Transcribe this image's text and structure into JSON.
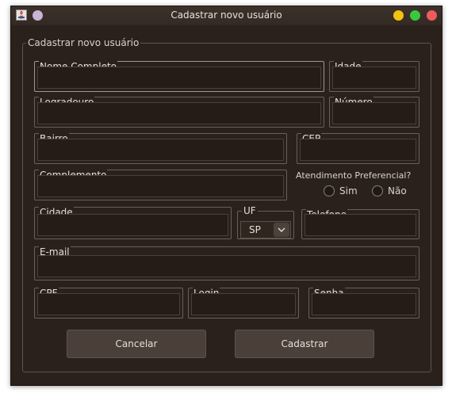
{
  "window": {
    "title": "Cadastrar novo usuário"
  },
  "form": {
    "group_title": "Cadastrar novo usuário",
    "fields": {
      "nome": {
        "label": "Nome Completo",
        "value": ""
      },
      "idade": {
        "label": "Idade",
        "value": ""
      },
      "logradouro": {
        "label": "Logradouro",
        "value": ""
      },
      "numero": {
        "label": "Número",
        "value": ""
      },
      "bairro": {
        "label": "Bairro",
        "value": ""
      },
      "cep": {
        "label": "CEP",
        "value": ""
      },
      "complemento": {
        "label": "Complemento",
        "value": ""
      },
      "cidade": {
        "label": "Cidade",
        "value": ""
      },
      "telefone": {
        "label": "Telefone",
        "value": ""
      },
      "email": {
        "label": "E-mail",
        "value": ""
      },
      "cpf": {
        "label": "CPF",
        "value": ""
      },
      "login": {
        "label": "Login",
        "value": ""
      },
      "senha": {
        "label": "Senha",
        "value": ""
      }
    },
    "preferencial": {
      "question": "Atendimento Preferencial?",
      "options": [
        "Sim",
        "Não"
      ]
    },
    "uf": {
      "label": "UF",
      "selected": "SP"
    },
    "buttons": {
      "cancel": "Cancelar",
      "submit": "Cadastrar"
    }
  },
  "colors": {
    "window_bg": "#2b211c",
    "titlebar": "#3c312b",
    "minimize": "#f4c20d",
    "maximize": "#38c93c",
    "close": "#f15b5b"
  }
}
